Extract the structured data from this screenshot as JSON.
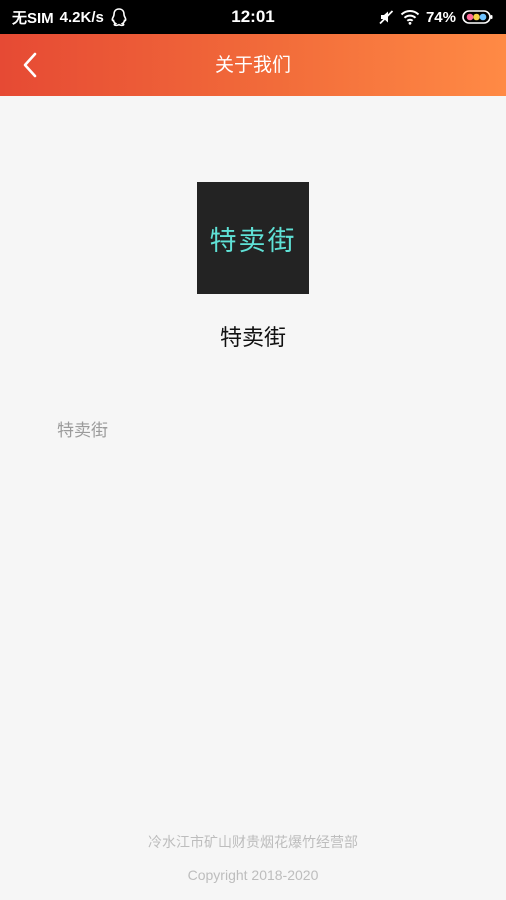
{
  "status_bar": {
    "carrier": "无SIM",
    "network_speed": "4.2K/s",
    "time": "12:01",
    "battery": "74%",
    "icons": [
      "qq-icon",
      "mute-icon",
      "wifi-icon",
      "battery-icon"
    ]
  },
  "header": {
    "title": "关于我们",
    "back_icon": "chevron-left-icon",
    "gradient_start": "#e64a34",
    "gradient_end": "#ff8a45"
  },
  "about": {
    "logo_text": "特卖街",
    "logo_bg": "#232323",
    "logo_text_color": "#5fe1d6",
    "app_name": "特卖街",
    "description": "特卖街"
  },
  "footer": {
    "company": "冷水江市矿山财贵烟花爆竹经营部",
    "copyright": "Copyright 2018-2020"
  }
}
